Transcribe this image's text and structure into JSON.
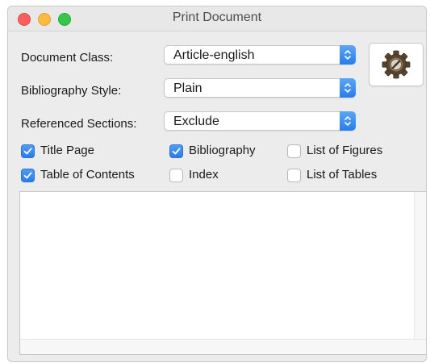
{
  "window": {
    "title": "Print Document"
  },
  "form": {
    "document_class_label": "Document Class:",
    "document_class_value": "Article-english",
    "bibliography_style_label": "Bibliography Style:",
    "bibliography_style_value": "Plain",
    "referenced_sections_label": "Referenced Sections:",
    "referenced_sections_value": "Exclude"
  },
  "options": [
    {
      "label": "Title Page",
      "checked": true
    },
    {
      "label": "Bibliography",
      "checked": true
    },
    {
      "label": "List of Figures",
      "checked": false
    },
    {
      "label": "Table of Contents",
      "checked": true
    },
    {
      "label": "Index",
      "checked": false
    },
    {
      "label": "List of Tables",
      "checked": false
    }
  ],
  "icons": {
    "settings_button": "gear-icon",
    "popup_arrows": "updown-chevron-icon",
    "checkmark": "checkmark-icon"
  },
  "colors": {
    "accent": "#2b7ce9",
    "close": "#fc605c",
    "minimize": "#fdbc40",
    "zoom": "#34c84a"
  }
}
